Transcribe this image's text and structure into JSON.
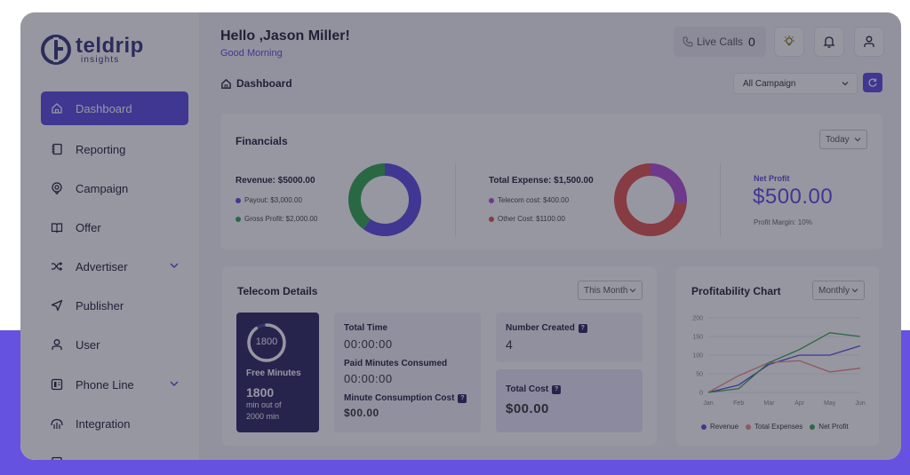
{
  "brand": {
    "name": "teldrip",
    "sub": "insights"
  },
  "sidebar": {
    "items": [
      {
        "label": "Dashboard",
        "icon": "home-icon"
      },
      {
        "label": "Reporting",
        "icon": "notebook-icon"
      },
      {
        "label": "Campaign",
        "icon": "target-icon"
      },
      {
        "label": "Offer",
        "icon": "book-icon"
      },
      {
        "label": "Advertiser",
        "icon": "shuffle-icon"
      },
      {
        "label": "Publisher",
        "icon": "send-icon"
      },
      {
        "label": "User",
        "icon": "user-icon"
      },
      {
        "label": "Phone Line",
        "icon": "phone-line-icon"
      },
      {
        "label": "Integration",
        "icon": "integration-icon"
      }
    ]
  },
  "header": {
    "greeting": "Hello ,Jason Miller!",
    "subgreeting": "Good Morning",
    "live_calls_label": "Live Calls",
    "live_calls_count": "0",
    "breadcrumb": "Dashboard",
    "campaign_select": "All Campaign"
  },
  "financials": {
    "title": "Financials",
    "period": "Today",
    "revenue": {
      "label": "Revenue: $5000.00",
      "items": [
        {
          "label": "Payout: $3,000.00",
          "color": "#5a4be0"
        },
        {
          "label": "Gross Profit: $2,000.00",
          "color": "#2fa84f"
        }
      ],
      "slices": [
        3000,
        2000
      ]
    },
    "expense": {
      "label": "Total Expense: $1,500.00",
      "items": [
        {
          "label": "Telecom cost: $400.00",
          "color": "#b44fd6"
        },
        {
          "label": "Other Cost: $1100.00",
          "color": "#e0524e"
        }
      ],
      "slices": [
        400,
        1100
      ]
    },
    "net_profit": {
      "label": "Net Profit",
      "value": "$500.00",
      "margin": "Profit Margin: 10%"
    }
  },
  "telecom": {
    "title": "Telecom Details",
    "period": "This Month",
    "free_minutes": {
      "ring_value": "1800",
      "label": "Free Minutes",
      "value": "1800",
      "sub1": "min out of",
      "sub2": "2000 min",
      "fraction": 0.9
    },
    "total_time": {
      "label": "Total Time",
      "value": "00:00:00"
    },
    "paid_minutes": {
      "label": "Paid Minutes Consumed",
      "value": "00:00:00"
    },
    "consumption_cost": {
      "label": "Minute Consumption Cost",
      "value": "$00.00"
    },
    "number_created": {
      "label": "Number Created",
      "value": "4"
    },
    "total_cost": {
      "label": "Total Cost",
      "value": "$00.00"
    },
    "help_glyph": "?"
  },
  "profit_chart": {
    "title": "Profitability Chart",
    "period": "Monthly"
  },
  "chart_data": {
    "type": "line",
    "x": [
      "Jan",
      "Feb",
      "Mar",
      "Apr",
      "May",
      "Jun"
    ],
    "ylim": [
      0,
      200
    ],
    "yticks": [
      0,
      50,
      100,
      150,
      200
    ],
    "grid": true,
    "legend": "bottom",
    "series": [
      {
        "name": "Revenue",
        "color": "#5a4be0",
        "values": [
          0,
          20,
          75,
          100,
          100,
          125
        ]
      },
      {
        "name": "Total Expenses",
        "color": "#f08a86",
        "values": [
          0,
          45,
          80,
          85,
          55,
          65
        ]
      },
      {
        "name": "Net Profit",
        "color": "#2fa84f",
        "values": [
          0,
          10,
          80,
          115,
          160,
          150
        ]
      }
    ]
  }
}
